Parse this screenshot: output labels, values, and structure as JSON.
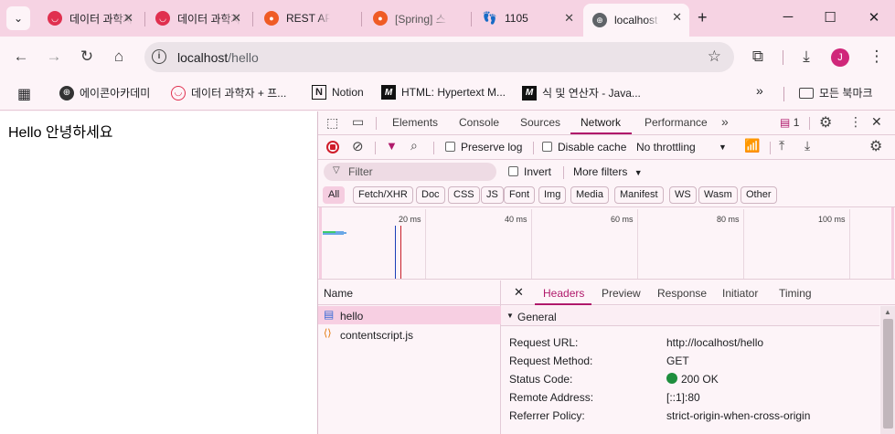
{
  "colors": {
    "tabstrip": "#f6d3e3",
    "accent": "#d0277a",
    "status_ok": "#1e8e3e"
  },
  "tabs": [
    {
      "title": "데이터 과학자 + 프",
      "icon": "codeit-icon",
      "active": false
    },
    {
      "title": "데이터 과학자 + 프",
      "icon": "codeit-icon",
      "active": false
    },
    {
      "title": "REST API",
      "icon": "postman-icon",
      "active": false
    },
    {
      "title": "[Spring] 스",
      "icon": "postman-icon",
      "active": false
    },
    {
      "title": "1105",
      "icon": "footprint-icon",
      "active": false
    },
    {
      "title": "localhost",
      "icon": "globe-icon",
      "active": true
    }
  ],
  "toolbar": {
    "url_host": "localhost",
    "url_path": "/hello",
    "avatar_letter": "J"
  },
  "bookmarks": [
    {
      "label": "에이콘아카데미",
      "icon": "globe-icon"
    },
    {
      "label": "데이터 과학자 + 프...",
      "icon": "codeit-icon"
    },
    {
      "label": "Notion",
      "icon": "notion-icon"
    },
    {
      "label": "HTML: Hypertext M...",
      "icon": "mdn-icon"
    },
    {
      "label": "식 및 연산자 - Java...",
      "icon": "mdn-icon"
    }
  ],
  "bookmarks_folder": "모든 북마크",
  "page": {
    "text": "Hello 안녕하세요"
  },
  "devtools": {
    "tabs": [
      "Elements",
      "Console",
      "Sources",
      "Network",
      "Performance"
    ],
    "selected_tab": "Network",
    "issues_count": "1",
    "preserve_log": "Preserve log",
    "disable_cache": "Disable cache",
    "throttling": "No throttling",
    "filter_placeholder": "Filter",
    "invert": "Invert",
    "more_filters": "More filters",
    "type_filters": [
      "All",
      "Fetch/XHR",
      "Doc",
      "CSS",
      "JS",
      "Font",
      "Img",
      "Media",
      "Manifest",
      "WS",
      "Wasm",
      "Other"
    ],
    "timeline_ticks": [
      "20 ms",
      "40 ms",
      "60 ms",
      "80 ms",
      "100 ms"
    ],
    "name_header": "Name",
    "requests": [
      {
        "name": "hello",
        "icon": "document-icon",
        "selected": true
      },
      {
        "name": "contentscript.js",
        "icon": "script-icon",
        "selected": false
      }
    ],
    "detail_tabs": [
      "Headers",
      "Preview",
      "Response",
      "Initiator",
      "Timing"
    ],
    "detail_selected": "Headers",
    "general_title": "General",
    "general": [
      {
        "key": "Request URL:",
        "value": "http://localhost/hello"
      },
      {
        "key": "Request Method:",
        "value": "GET"
      },
      {
        "key": "Status Code:",
        "value": "200 OK"
      },
      {
        "key": "Remote Address:",
        "value": "[::1]:80"
      },
      {
        "key": "Referrer Policy:",
        "value": "strict-origin-when-cross-origin"
      }
    ]
  }
}
